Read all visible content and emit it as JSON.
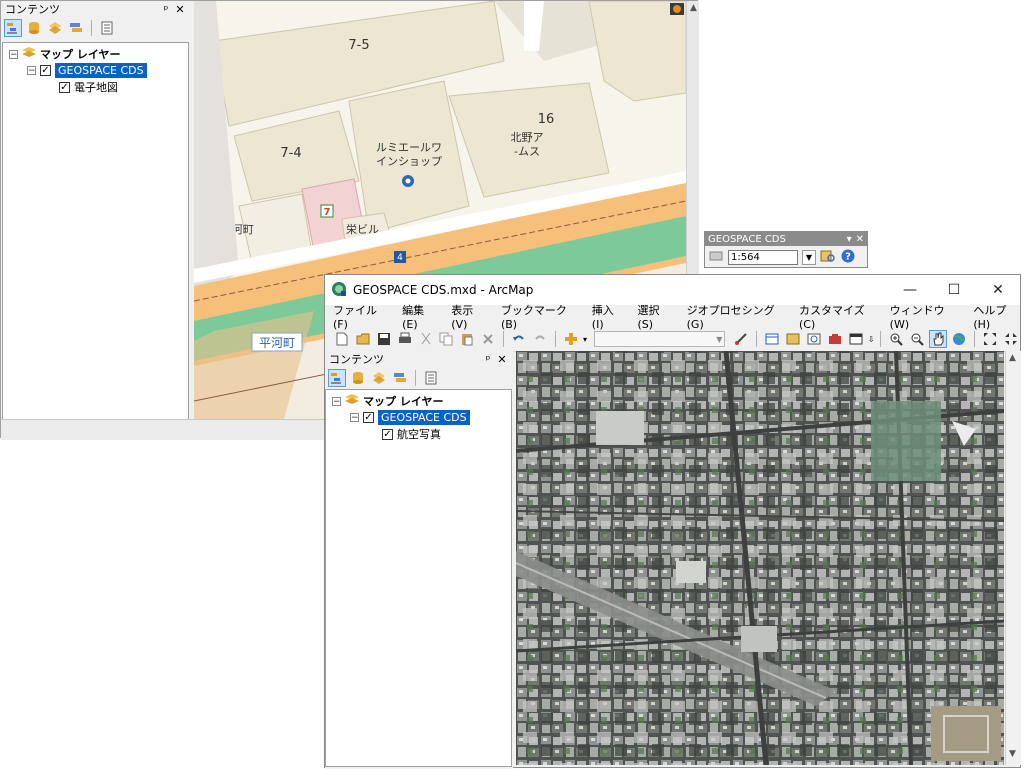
{
  "back_window": {
    "toc": {
      "title": "コンテンツ",
      "pin": "ᵖ",
      "close": "✕",
      "root_label": "マップ レイヤー",
      "group_label": "GEOSPACE CDS",
      "layer_label": "電子地図",
      "expander_minus": "⊟",
      "check": "✓"
    },
    "map": {
      "labels": {
        "block_7_5": "7-5",
        "block_7_4": "7-4",
        "block_16": "16",
        "lumiere": "ルミエールワ\nインショップ",
        "kitano": "北野ア\n-ムス",
        "pmo": "PMO平河町",
        "sakae": "栄ビル",
        "route": "4",
        "hirakawa": "平河町"
      }
    }
  },
  "floating_toolbar": {
    "title": "GEOSPACE CDS",
    "scale": "1:564",
    "menu_glyph": "▾",
    "close": "✕"
  },
  "front_window": {
    "title": "GEOSPACE CDS.mxd - ArcMap",
    "controls": {
      "minimize": "—",
      "maximize": "☐",
      "close": "✕"
    },
    "menu": [
      "ファイル(F)",
      "編集(E)",
      "表示(V)",
      "ブックマーク(B)",
      "挿入(I)",
      "選択(S)",
      "ジオプロセシング(G)",
      "カスタマイズ(C)",
      "ウィンドウ(W)",
      "ヘルプ(H)"
    ],
    "toc": {
      "title": "コンテンツ",
      "pin": "ᵖ",
      "close": "✕",
      "root_label": "マップ レイヤー",
      "group_label": "GEOSPACE CDS",
      "layer_label": "航空写真",
      "check": "✓"
    }
  },
  "colors": {
    "selection": "#0a62c2",
    "map_bg": "#f7f4ec",
    "building": "#ece6d2",
    "road_orange": "#f6c07a",
    "green_strip": "#7dc99a",
    "aerial_base": "#5d625f"
  }
}
